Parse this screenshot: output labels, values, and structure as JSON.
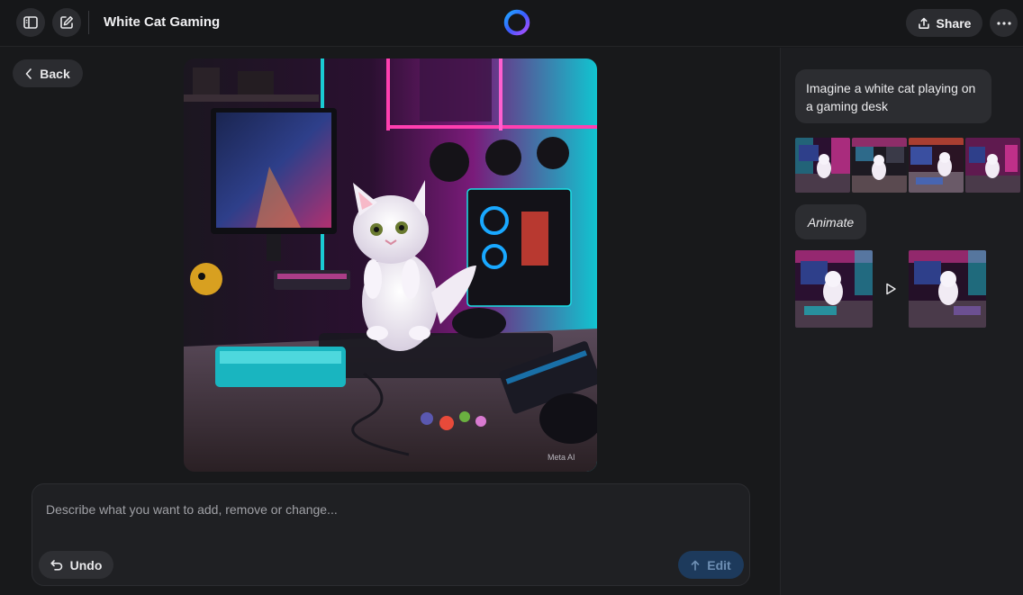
{
  "header": {
    "title": "White Cat Gaming",
    "share_label": "Share",
    "icons": {
      "sidebar_toggle": "sidebar-toggle-icon",
      "new_chat": "new-chat-icon",
      "logo": "meta-ai-logo",
      "share": "share-icon",
      "more": "more-icon"
    }
  },
  "main": {
    "back_label": "Back",
    "image_watermark": "Meta AI"
  },
  "composer": {
    "placeholder": "Describe what you want to add, remove or change...",
    "value": "",
    "undo_label": "Undo",
    "edit_label": "Edit"
  },
  "side": {
    "prompt": "Imagine a white cat playing on a gaming desk",
    "thumbnail_count": 4,
    "animate_label": "Animate"
  },
  "colors": {
    "background": "#18191b",
    "surface": "#2b2c30",
    "edit_button": "#1d3a5c",
    "neon_pink": "#ff3fb0",
    "neon_cyan": "#19e0e6",
    "neon_purple": "#8b3dff"
  }
}
